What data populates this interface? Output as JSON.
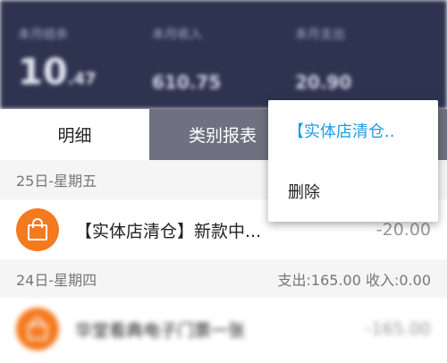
{
  "header": {
    "stats": [
      {
        "label": "本月结余",
        "value": "10",
        "suffix": ".47"
      },
      {
        "label": "本月收入",
        "value": "610.75"
      },
      {
        "label": "本月支出",
        "value": "20.90"
      }
    ]
  },
  "tabs": [
    {
      "label": "明细",
      "active": true
    },
    {
      "label": "类别报表",
      "active": false
    }
  ],
  "days": [
    {
      "date": "25日-星期五",
      "summary": "",
      "items": [
        {
          "title": "【实体店清仓】新款中...",
          "amount": "-20.00",
          "icon": "shopping-bag-icon"
        }
      ]
    },
    {
      "date": "24日-星期四",
      "summary": "支出:165.00 收入:0.00",
      "items": [
        {
          "title": "华堂看典电子门票一张",
          "amount": "-165.00",
          "icon": "shopping-bag-icon"
        }
      ]
    }
  ],
  "context_menu": {
    "items": [
      {
        "label": "【实体店清仓.."
      },
      {
        "label": "删除"
      }
    ]
  },
  "colors": {
    "header_bg": "#2e3350",
    "tab_inactive_bg": "#6f7180",
    "accent_orange": "#f47a20",
    "menu_highlight": "#1e9be6"
  }
}
